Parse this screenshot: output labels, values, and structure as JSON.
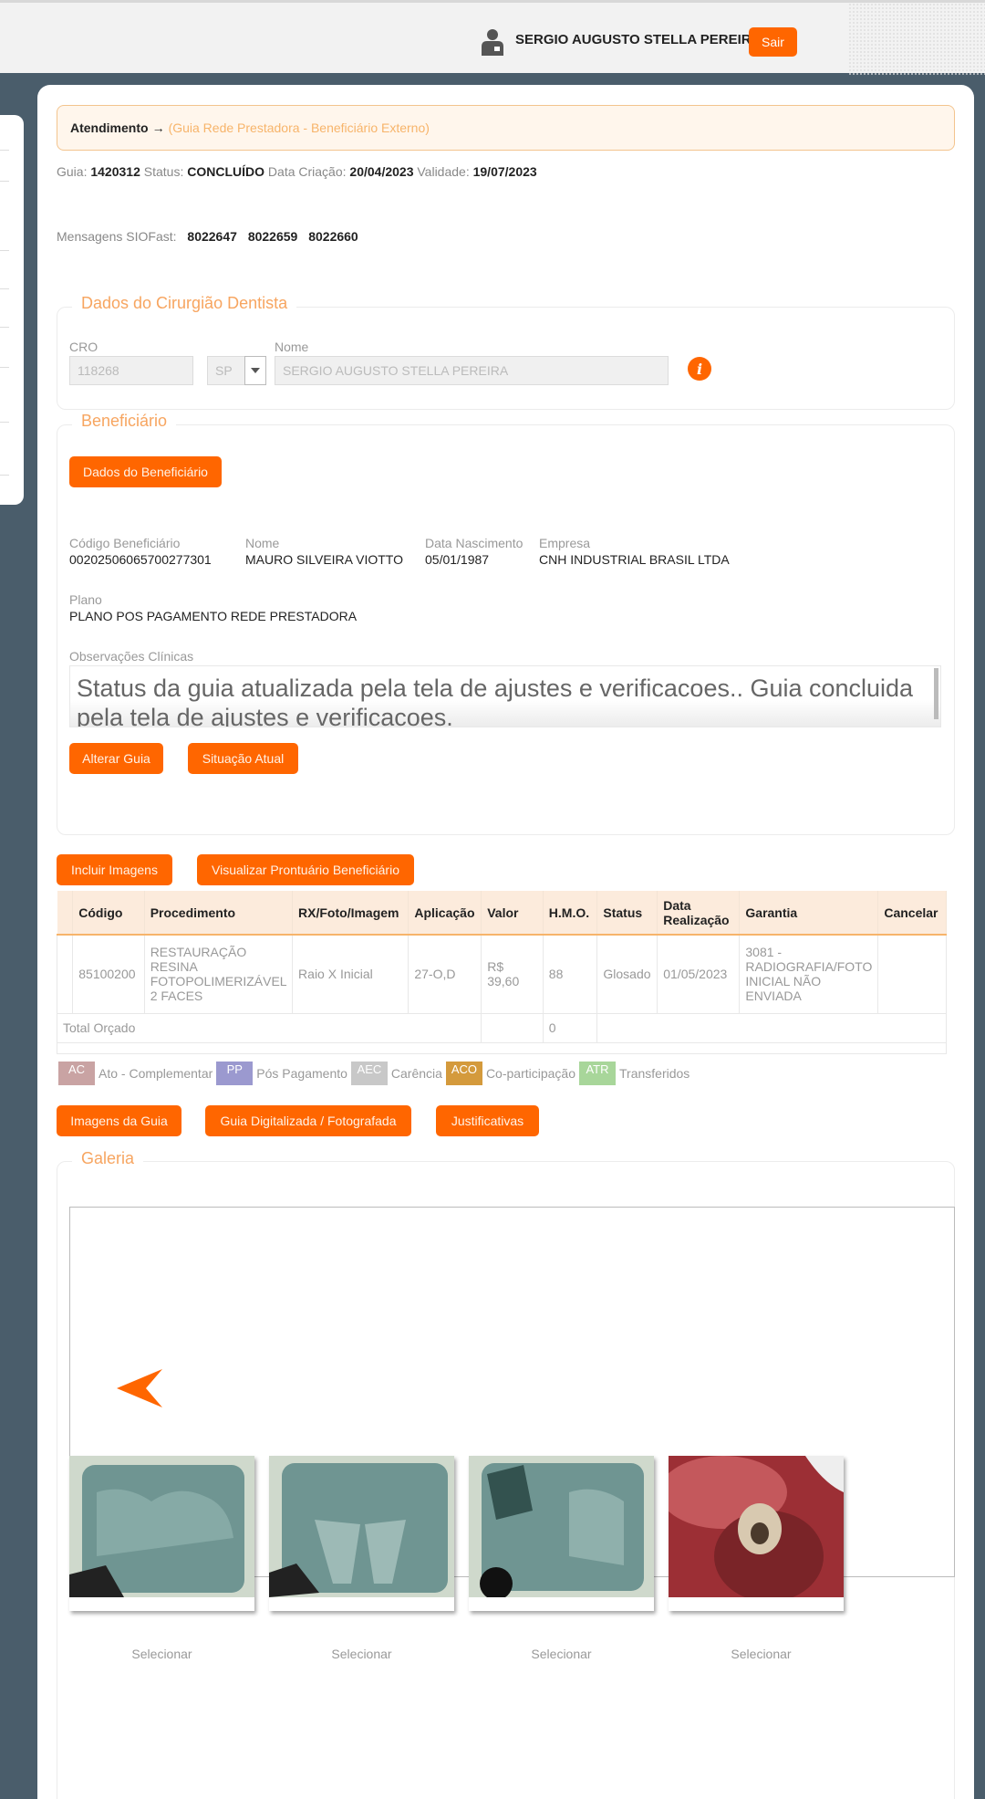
{
  "header": {
    "user_name": "SERGIO AUGUSTO STELLA PEREIRA",
    "logout_label": "Sair"
  },
  "breadcrumb": {
    "main": "Atendimento",
    "sub": "(Guia Rede Prestadora - Beneficiário Externo)"
  },
  "guide": {
    "guia_label": "Guia:",
    "guia": "1420312",
    "status_label": "Status:",
    "status": "CONCLUÍDO",
    "data_criacao_label": "Data Criação:",
    "data_criacao": "20/04/2023",
    "validade_label": "Validade:",
    "validade": "19/07/2023"
  },
  "messages": {
    "label": "Mensagens SIOFast:",
    "codes": [
      "8022647",
      "8022659",
      "8022660"
    ]
  },
  "dentist": {
    "legend": "Dados do Cirurgião Dentista",
    "cro_label": "CRO",
    "cro": "118268",
    "uf": "SP",
    "nome_label": "Nome",
    "nome": "SERGIO AUGUSTO STELLA PEREIRA"
  },
  "beneficiary": {
    "legend": "Beneficiário",
    "dados_button": "Dados do Beneficiário",
    "codigo_label": "Código Beneficiário",
    "codigo": "00202506065700277301",
    "nome_label": "Nome",
    "nome": "MAURO SILVEIRA VIOTTO",
    "nasc_label": "Data Nascimento",
    "nasc": "05/01/1987",
    "empresa_label": "Empresa",
    "empresa": "CNH INDUSTRIAL BRASIL LTDA",
    "plano_label": "Plano",
    "plano": "PLANO POS PAGAMENTO REDE PRESTADORA",
    "obs_label": "Observações Clínicas",
    "obs": "Status da guia atualizada pela tela de ajustes e verificacoes.. Guia concluida pela tela de ajustes e verificacoes.",
    "alterar_button": "Alterar Guia",
    "situacao_button": "Situação Atual"
  },
  "actions": {
    "incluir_imagens": "Incluir Imagens",
    "visualizar_prontuario": "Visualizar Prontuário Beneficiário"
  },
  "table": {
    "headers": [
      "Código",
      "Procedimento",
      "RX/Foto/Imagem",
      "Aplicação",
      "Valor",
      "H.M.O.",
      "Status",
      "Data Realização",
      "Garantia",
      "Cancelar"
    ],
    "rows": [
      {
        "codigo": "85100200",
        "procedimento": "RESTAURAÇÃO RESINA FOTOPOLIMERIZÁVEL 2 FACES",
        "rx": "Raio X Inicial",
        "aplicacao": "27-O,D",
        "valor": "R$ 39,60",
        "hmo": "88",
        "status": "Glosado",
        "data": "01/05/2023",
        "garantia": "3081 - RADIOGRAFIA/FOTO INICIAL NÃO ENVIADA"
      }
    ],
    "total_label": "Total Orçado",
    "total_hmo": "0"
  },
  "legend_items": [
    {
      "abbr": "AC",
      "label": "Ato - Complementar",
      "color": "#c9a3a3"
    },
    {
      "abbr": "PP",
      "label": "Pós Pagamento",
      "color": "#9b99cf"
    },
    {
      "abbr": "AEC",
      "label": "Carência",
      "color": "#c8c8c8"
    },
    {
      "abbr": "ACO",
      "label": "Co-participação",
      "color": "#d49a3c"
    },
    {
      "abbr": "ATR",
      "label": "Transferidos",
      "color": "#a8d69a"
    }
  ],
  "bottom_actions": {
    "imagens_guia": "Imagens da Guia",
    "guia_digitalizada": "Guia Digitalizada / Fotografada",
    "justificativas": "Justificativas"
  },
  "gallery": {
    "legend": "Galeria",
    "select_label": "Selecionar"
  },
  "colors": {
    "accent": "#ff6600",
    "background": "#4a5d6b"
  }
}
